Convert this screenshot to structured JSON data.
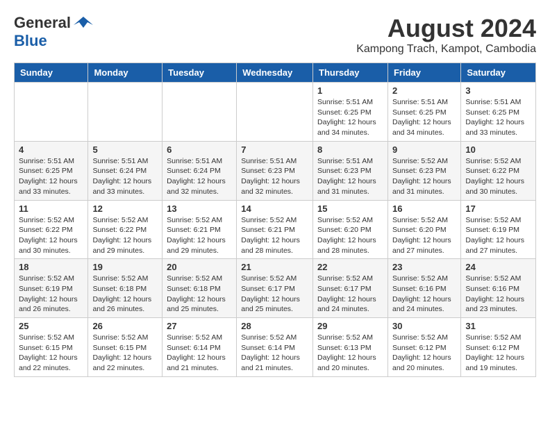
{
  "header": {
    "logo_general": "General",
    "logo_blue": "Blue",
    "title": "August 2024",
    "subtitle": "Kampong Trach, Kampot, Cambodia"
  },
  "days_of_week": [
    "Sunday",
    "Monday",
    "Tuesday",
    "Wednesday",
    "Thursday",
    "Friday",
    "Saturday"
  ],
  "weeks": [
    [
      {
        "day": "",
        "info": ""
      },
      {
        "day": "",
        "info": ""
      },
      {
        "day": "",
        "info": ""
      },
      {
        "day": "",
        "info": ""
      },
      {
        "day": "1",
        "info": "Sunrise: 5:51 AM\nSunset: 6:25 PM\nDaylight: 12 hours\nand 34 minutes."
      },
      {
        "day": "2",
        "info": "Sunrise: 5:51 AM\nSunset: 6:25 PM\nDaylight: 12 hours\nand 34 minutes."
      },
      {
        "day": "3",
        "info": "Sunrise: 5:51 AM\nSunset: 6:25 PM\nDaylight: 12 hours\nand 33 minutes."
      }
    ],
    [
      {
        "day": "4",
        "info": "Sunrise: 5:51 AM\nSunset: 6:25 PM\nDaylight: 12 hours\nand 33 minutes."
      },
      {
        "day": "5",
        "info": "Sunrise: 5:51 AM\nSunset: 6:24 PM\nDaylight: 12 hours\nand 33 minutes."
      },
      {
        "day": "6",
        "info": "Sunrise: 5:51 AM\nSunset: 6:24 PM\nDaylight: 12 hours\nand 32 minutes."
      },
      {
        "day": "7",
        "info": "Sunrise: 5:51 AM\nSunset: 6:23 PM\nDaylight: 12 hours\nand 32 minutes."
      },
      {
        "day": "8",
        "info": "Sunrise: 5:51 AM\nSunset: 6:23 PM\nDaylight: 12 hours\nand 31 minutes."
      },
      {
        "day": "9",
        "info": "Sunrise: 5:52 AM\nSunset: 6:23 PM\nDaylight: 12 hours\nand 31 minutes."
      },
      {
        "day": "10",
        "info": "Sunrise: 5:52 AM\nSunset: 6:22 PM\nDaylight: 12 hours\nand 30 minutes."
      }
    ],
    [
      {
        "day": "11",
        "info": "Sunrise: 5:52 AM\nSunset: 6:22 PM\nDaylight: 12 hours\nand 30 minutes."
      },
      {
        "day": "12",
        "info": "Sunrise: 5:52 AM\nSunset: 6:22 PM\nDaylight: 12 hours\nand 29 minutes."
      },
      {
        "day": "13",
        "info": "Sunrise: 5:52 AM\nSunset: 6:21 PM\nDaylight: 12 hours\nand 29 minutes."
      },
      {
        "day": "14",
        "info": "Sunrise: 5:52 AM\nSunset: 6:21 PM\nDaylight: 12 hours\nand 28 minutes."
      },
      {
        "day": "15",
        "info": "Sunrise: 5:52 AM\nSunset: 6:20 PM\nDaylight: 12 hours\nand 28 minutes."
      },
      {
        "day": "16",
        "info": "Sunrise: 5:52 AM\nSunset: 6:20 PM\nDaylight: 12 hours\nand 27 minutes."
      },
      {
        "day": "17",
        "info": "Sunrise: 5:52 AM\nSunset: 6:19 PM\nDaylight: 12 hours\nand 27 minutes."
      }
    ],
    [
      {
        "day": "18",
        "info": "Sunrise: 5:52 AM\nSunset: 6:19 PM\nDaylight: 12 hours\nand 26 minutes."
      },
      {
        "day": "19",
        "info": "Sunrise: 5:52 AM\nSunset: 6:18 PM\nDaylight: 12 hours\nand 26 minutes."
      },
      {
        "day": "20",
        "info": "Sunrise: 5:52 AM\nSunset: 6:18 PM\nDaylight: 12 hours\nand 25 minutes."
      },
      {
        "day": "21",
        "info": "Sunrise: 5:52 AM\nSunset: 6:17 PM\nDaylight: 12 hours\nand 25 minutes."
      },
      {
        "day": "22",
        "info": "Sunrise: 5:52 AM\nSunset: 6:17 PM\nDaylight: 12 hours\nand 24 minutes."
      },
      {
        "day": "23",
        "info": "Sunrise: 5:52 AM\nSunset: 6:16 PM\nDaylight: 12 hours\nand 24 minutes."
      },
      {
        "day": "24",
        "info": "Sunrise: 5:52 AM\nSunset: 6:16 PM\nDaylight: 12 hours\nand 23 minutes."
      }
    ],
    [
      {
        "day": "25",
        "info": "Sunrise: 5:52 AM\nSunset: 6:15 PM\nDaylight: 12 hours\nand 22 minutes."
      },
      {
        "day": "26",
        "info": "Sunrise: 5:52 AM\nSunset: 6:15 PM\nDaylight: 12 hours\nand 22 minutes."
      },
      {
        "day": "27",
        "info": "Sunrise: 5:52 AM\nSunset: 6:14 PM\nDaylight: 12 hours\nand 21 minutes."
      },
      {
        "day": "28",
        "info": "Sunrise: 5:52 AM\nSunset: 6:14 PM\nDaylight: 12 hours\nand 21 minutes."
      },
      {
        "day": "29",
        "info": "Sunrise: 5:52 AM\nSunset: 6:13 PM\nDaylight: 12 hours\nand 20 minutes."
      },
      {
        "day": "30",
        "info": "Sunrise: 5:52 AM\nSunset: 6:12 PM\nDaylight: 12 hours\nand 20 minutes."
      },
      {
        "day": "31",
        "info": "Sunrise: 5:52 AM\nSunset: 6:12 PM\nDaylight: 12 hours\nand 19 minutes."
      }
    ]
  ]
}
